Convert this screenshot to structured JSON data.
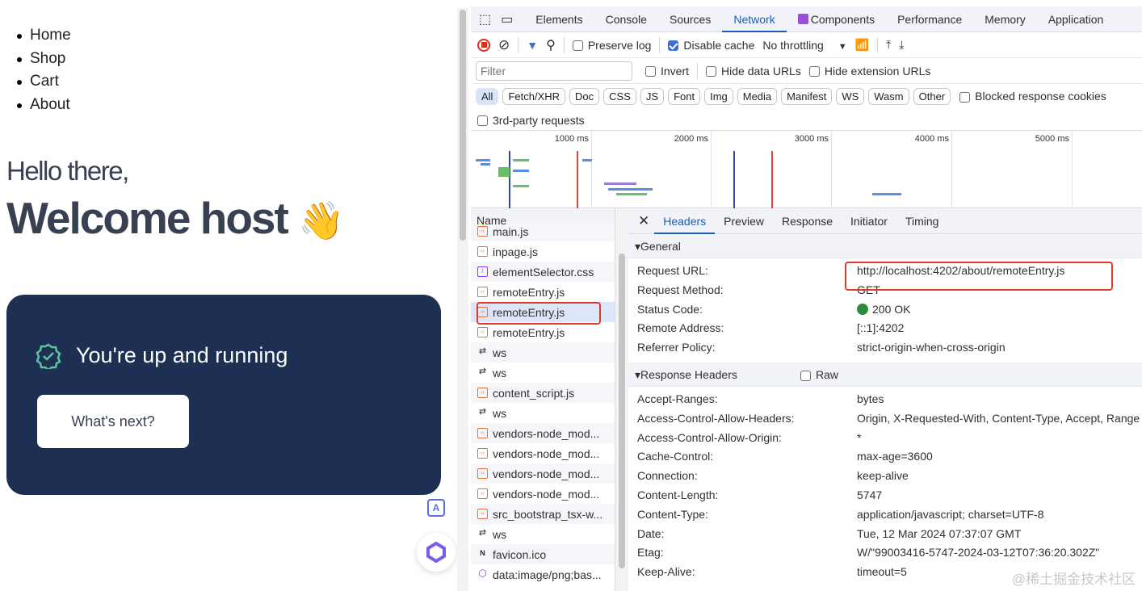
{
  "page": {
    "nav": [
      "Home",
      "Shop",
      "Cart",
      "About"
    ],
    "greeting": "Hello there,",
    "welcome": "Welcome host",
    "wave": "👋",
    "status": "You're up and running",
    "next_button": "What's next?",
    "float_icon": "A"
  },
  "devtools": {
    "tabs": [
      "Elements",
      "Console",
      "Sources",
      "Network",
      "Components",
      "Performance",
      "Memory",
      "Application"
    ],
    "active_tab": "Network",
    "toolbar": {
      "preserve_log": "Preserve log",
      "disable_cache": "Disable cache",
      "throttling": "No throttling"
    },
    "filter": {
      "placeholder": "Filter",
      "invert": "Invert",
      "hide_data": "Hide data URLs",
      "hide_ext": "Hide extension URLs"
    },
    "types": [
      "All",
      "Fetch/XHR",
      "Doc",
      "CSS",
      "JS",
      "Font",
      "Img",
      "Media",
      "Manifest",
      "WS",
      "Wasm",
      "Other"
    ],
    "blocked": "Blocked response cookies",
    "third_party": "3rd-party requests",
    "timeline": [
      "1000 ms",
      "2000 ms",
      "3000 ms",
      "4000 ms",
      "5000 ms"
    ],
    "name_header": "Name",
    "requests": [
      "main.js",
      "inpage.js",
      "elementSelector.css",
      "remoteEntry.js",
      "remoteEntry.js",
      "remoteEntry.js",
      "ws",
      "ws",
      "content_script.js",
      "ws",
      "vendors-node_mod...",
      "vendors-node_mod...",
      "vendors-node_mod...",
      "vendors-node_mod...",
      "src_bootstrap_tsx-w...",
      "ws",
      "favicon.ico",
      "data:image/png;bas..."
    ],
    "detail_tabs": [
      "Headers",
      "Preview",
      "Response",
      "Initiator",
      "Timing"
    ],
    "general_title": "▾General",
    "general": [
      [
        "Request URL:",
        "http://localhost:4202/about/remoteEntry.js"
      ],
      [
        "Request Method:",
        "GET"
      ],
      [
        "Status Code:",
        "200 OK"
      ],
      [
        "Remote Address:",
        "[::1]:4202"
      ],
      [
        "Referrer Policy:",
        "strict-origin-when-cross-origin"
      ]
    ],
    "response_title": "▾Response Headers",
    "raw": "Raw",
    "response": [
      [
        "Accept-Ranges:",
        "bytes"
      ],
      [
        "Access-Control-Allow-Headers:",
        "Origin, X-Requested-With, Content-Type, Accept, Range"
      ],
      [
        "Access-Control-Allow-Origin:",
        "*"
      ],
      [
        "Cache-Control:",
        "max-age=3600"
      ],
      [
        "Connection:",
        "keep-alive"
      ],
      [
        "Content-Length:",
        "5747"
      ],
      [
        "Content-Type:",
        "application/javascript; charset=UTF-8"
      ],
      [
        "Date:",
        "Tue, 12 Mar 2024 07:37:07 GMT"
      ],
      [
        "Etag:",
        "W/\"99003416-5747-2024-03-12T07:36:20.302Z\""
      ],
      [
        "Keep-Alive:",
        "timeout=5"
      ]
    ]
  },
  "watermark": "@稀土掘金技术社区"
}
